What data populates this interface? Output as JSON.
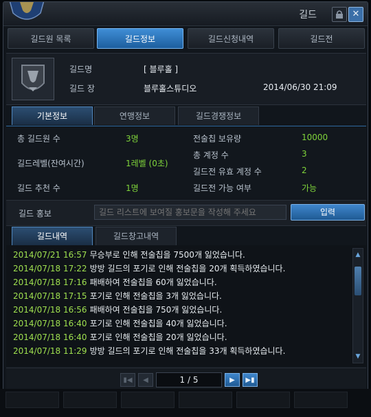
{
  "window": {
    "title": "길드"
  },
  "top_tabs": [
    {
      "label": "길드원 목록",
      "active": false
    },
    {
      "label": "길드정보",
      "active": true
    },
    {
      "label": "길드신청내역",
      "active": false
    },
    {
      "label": "길드전",
      "active": false
    }
  ],
  "guild": {
    "name_label": "길드명",
    "name_value": "[ 블루홀 ]",
    "master_label": "길드 장",
    "master_value": "블루홀스튜디오",
    "created": "2014/06/30 21:09"
  },
  "sub_tabs": [
    {
      "label": "기본정보",
      "active": true
    },
    {
      "label": "연맹정보",
      "active": false
    },
    {
      "label": "길드경쟁정보",
      "active": false
    }
  ],
  "stats": {
    "total_members_label": "총 길드원 수",
    "total_members_value": "3명",
    "level_label": "길드레벨(잔여시간)",
    "level_value": "1레벨 (0초)",
    "recommend_label": "길드 추천 수",
    "recommend_value": "1명",
    "tactics_chip_label": "전술칩 보유량",
    "tactics_chip_value": "10000",
    "total_accounts_label": "총 계정 수",
    "total_accounts_value": "3",
    "war_accounts_label": "길드전 유효 계정 수",
    "war_accounts_value": "2",
    "war_available_label": "길드전 가능 여부",
    "war_available_value": "가능"
  },
  "promo": {
    "label": "길드 홍보",
    "placeholder": "길드 리스트에 보여질 홍보문을 작성해 주세요",
    "button": "입력"
  },
  "log_tabs": [
    {
      "label": "길드내역",
      "active": true
    },
    {
      "label": "길드창고내역",
      "active": false
    }
  ],
  "log": [
    {
      "date": "2014/07/21 16:57",
      "text": "무승부로 인해 전술칩을 7500개 잃었습니다."
    },
    {
      "date": "2014/07/18 17:22",
      "text": "방방 길드의 포기로 인해 전술칩을 20개 획득하였습니다."
    },
    {
      "date": "2014/07/18 17:16",
      "text": "패배하여 전술칩을 60개 잃었습니다."
    },
    {
      "date": "2014/07/18 17:15",
      "text": "포기로 인해 전술칩을 3개 잃었습니다."
    },
    {
      "date": "2014/07/18 16:56",
      "text": "패배하여 전술칩을 750개 잃었습니다."
    },
    {
      "date": "2014/07/18 16:40",
      "text": "포기로 인해 전술칩을 40개 잃었습니다."
    },
    {
      "date": "2014/07/18 16:40",
      "text": "포기로 인해 전술칩을 20개 잃었습니다."
    },
    {
      "date": "2014/07/18 11:29",
      "text": "방방 길드의 포기로 인해 전술칩을 33개 획득하였습니다."
    }
  ],
  "pager": {
    "page": "1 / 5"
  },
  "colors": {
    "accent": "#2f78c0",
    "value_green": "#7fd43a",
    "date_green": "#9fe04f"
  },
  "icons": [
    "guild-emblem-icon",
    "lock-icon",
    "close-icon",
    "first-page-icon",
    "prev-page-icon",
    "next-page-icon",
    "last-page-icon",
    "scroll-up-icon",
    "scroll-down-icon"
  ]
}
